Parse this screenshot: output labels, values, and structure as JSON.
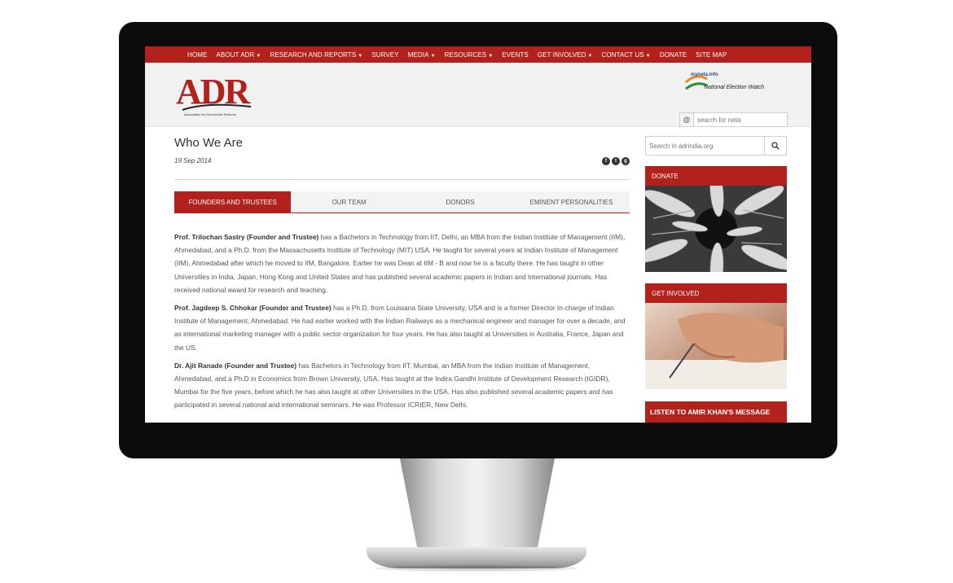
{
  "nav": [
    {
      "label": "HOME",
      "dropdown": false
    },
    {
      "label": "ABOUT ADR",
      "dropdown": true
    },
    {
      "label": "RESEARCH AND REPORTS",
      "dropdown": true
    },
    {
      "label": "SURVEY",
      "dropdown": false
    },
    {
      "label": "MEDIA",
      "dropdown": true
    },
    {
      "label": "RESOURCES",
      "dropdown": true
    },
    {
      "label": "EVENTS",
      "dropdown": false
    },
    {
      "label": "GET INVOLVED",
      "dropdown": true
    },
    {
      "label": "CONTACT US",
      "dropdown": true
    },
    {
      "label": "DONATE",
      "dropdown": false
    },
    {
      "label": "SITE MAP",
      "dropdown": false
    }
  ],
  "header": {
    "logo_text": "ADR",
    "logo_tagline": "Association for Democratic Reforms",
    "new_logo_text": "National Election Watch",
    "new_logo_mark": "myneta.info",
    "neta_search_placeholder": "search for neta",
    "at_symbol": "@"
  },
  "page": {
    "title": "Who We Are",
    "date": "19 Sep 2014",
    "share_icons": [
      "facebook-icon",
      "twitter-icon",
      "googleplus-icon"
    ]
  },
  "tabs": [
    {
      "label": "FOUNDERS AND TRUSTEES",
      "active": true
    },
    {
      "label": "OUR TEAM",
      "active": false
    },
    {
      "label": "DONORS",
      "active": false
    },
    {
      "label": "EMINENT PERSONALITIES",
      "active": false
    }
  ],
  "bios": [
    {
      "name": "Prof. Trilochan Sastry (Founder and Trustee)",
      "text": " has a Bachelors in Technology from IIT, Delhi, an MBA from the Indian Institute of Management (IIM), Ahmedabad, and a Ph.D. from the Massachusetts Institute of Technology (MIT) USA. He taught for several years at Indian Institute of Management (IIM), Ahmedabad after which he moved to IIM, Bangalore. Earlier he was Dean at IIM - B and now he is a faculty there. He has taught in other Universities in India, Japan, Hong Kong and United States and has published several academic papers in Indian and International journals. Has received national award for research and teaching."
    },
    {
      "name": "Prof. Jagdeep S. Chhokar (Founder and Trustee)",
      "text": " has a Ph.D. from Louisiana State University, USA and is a former Director In-charge of Indian Institute of Management, Ahmedabad. He had earlier worked with the Indian Railways as a mechanical engineer and manager for over a decade, and as international marketing manager with a public sector organization for four years. He has also taught at Universities in Australia, France, Japan and the US."
    },
    {
      "name": "Dr. Ajit Ranade (Founder and Trustee)",
      "text": " has Bachelors in Technology from IIT, Mumbai, an MBA from the Indian Institute of Management, Ahmedabad, and a Ph.D in Economics from Brown University, USA. Has taught at the Indira Gandhi Institute of Development Research (IGIDR), Mumbai for the five years, before which he has also taught at other Universities in the USA. Has also published several academic papers and has participated in several national and international seminars. He was Professor ICRIER, New Delhi."
    }
  ],
  "sidebar": {
    "search_placeholder": "Search in adrindia.org",
    "donate_label": "DONATE",
    "involved_label": "GET INVOLVED",
    "amir_label": "LISTEN TO AMIR KHAN'S MESSAGE"
  },
  "colors": {
    "brand_red": "#b3211c",
    "text": "#555555"
  }
}
